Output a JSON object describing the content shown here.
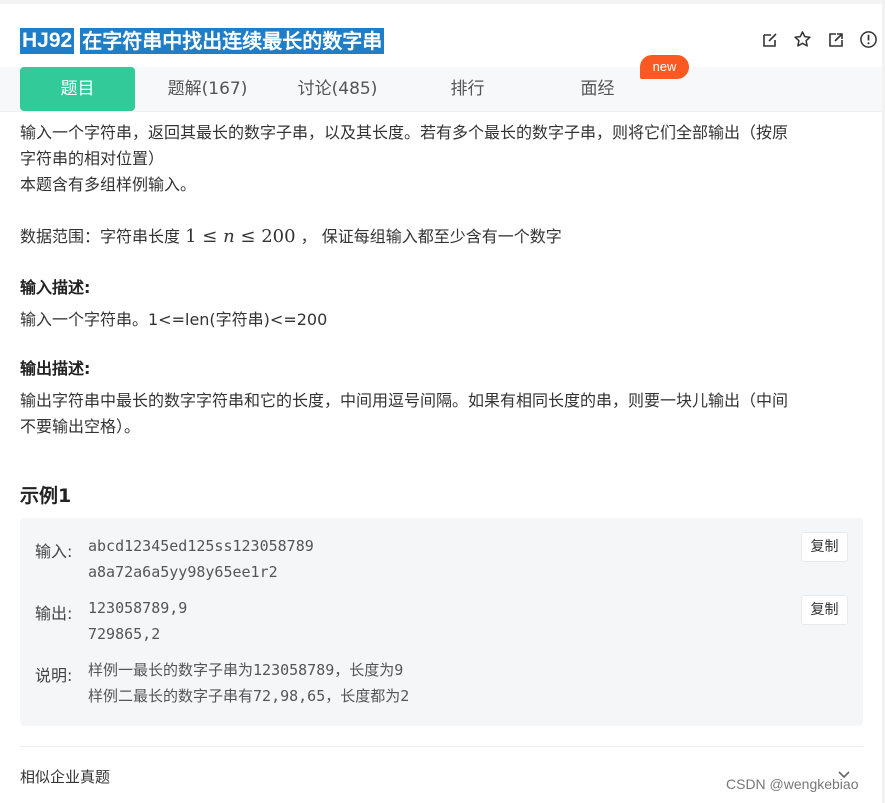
{
  "header": {
    "problem_id": "HJ92",
    "title": "在字符串中找出连续最长的数字串",
    "icons": [
      "edit-icon",
      "star-icon",
      "share-icon",
      "report-icon"
    ]
  },
  "tabs": [
    {
      "label": "题目",
      "active": true
    },
    {
      "label": "题解(167)",
      "active": false
    },
    {
      "label": "讨论(485)",
      "active": false
    },
    {
      "label": "排行",
      "active": false
    },
    {
      "label": "面经",
      "active": false
    }
  ],
  "badge": "new",
  "description": {
    "line1": "输入一个字符串，返回其最长的数字子串，以及其长度。若有多个最长的数字子串，则将它们全部输出（按原",
    "line2": "字符串的相对位置）",
    "line3": "本题含有多组样例输入。",
    "range_prefix": "数据范围：字符串长度",
    "range_math_a": "1 ≤ ",
    "range_math_n": "n",
    "range_math_b": " ≤ 200",
    "range_suffix": "，  保证每组输入都至少含有一个数字"
  },
  "input_section": {
    "heading": "输入描述:",
    "text": "输入一个字符串。1<=len(字符串)<=200"
  },
  "output_section": {
    "heading": "输出描述:",
    "line1": "输出字符串中最长的数字字符串和它的长度，中间用逗号间隔。如果有相同长度的串，则要一块儿输出（中间",
    "line2": "不要输出空格）。"
  },
  "example": {
    "heading": "示例1",
    "input_label": "输入:",
    "input_lines": [
      "abcd12345ed125ss123058789",
      "a8a72a6a5yy98y65ee1r2"
    ],
    "output_label": "输出:",
    "output_lines": [
      "123058789,9",
      "729865,2"
    ],
    "explain_label": "说明:",
    "explain_lines": [
      "样例一最长的数字子串为123058789，长度为9",
      "样例二最长的数字子串有72,98,65，长度都为2"
    ],
    "copy_label": "复制"
  },
  "footer": {
    "similar": "相似企业真题",
    "watermark": "CSDN @wengkebiao"
  },
  "colors": {
    "accent": "#32ca99",
    "title_highlight": "#1f7ec8",
    "badge": "#fa5a21"
  }
}
